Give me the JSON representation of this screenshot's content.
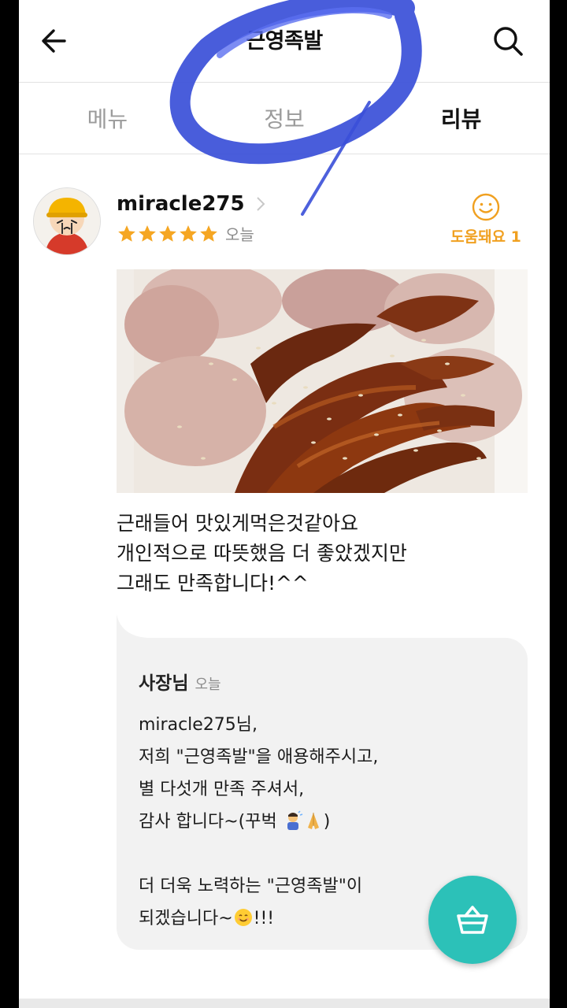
{
  "header": {
    "title": "근영족발",
    "back_icon": "arrow-left-icon",
    "search_icon": "search-icon"
  },
  "tabs": [
    {
      "label": "메뉴",
      "active": false
    },
    {
      "label": "정보",
      "active": false
    },
    {
      "label": "리뷰",
      "active": true
    }
  ],
  "review": {
    "username": "miracle275",
    "rating": 5,
    "date": "오늘",
    "helpful_label": "도움돼요 1",
    "text_lines": [
      "근래들어 맛있게먹은것같아요",
      "개인적으로 따뜻했음 더 좋았겠지만",
      "그래도 만족합니다!^^"
    ]
  },
  "reply": {
    "author": "사장님",
    "date": "오늘",
    "lines": [
      "miracle275님,",
      "저희  \"근영족발\"을 애용해주시고,",
      "별  다섯개  만족  주셔서,",
      "감사  합니다~(꾸벅 ",
      "",
      "더  더욱  노력하는 \"근영족발\"이",
      "되겠습니다~"
    ],
    "line4_end": ")",
    "line7_end": "!!!"
  },
  "cart_icon": "shopping-basket-icon",
  "colors": {
    "accent_teal": "#2cc1b8",
    "star_orange": "#f5a623",
    "helpful_orange": "#f0a020",
    "scribble_blue": "#3a4fd8"
  }
}
